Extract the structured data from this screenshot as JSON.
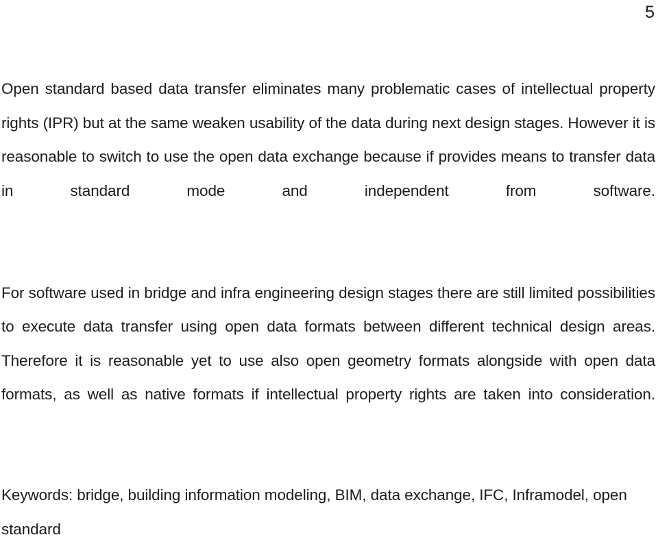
{
  "document": {
    "page_number": "5",
    "text_color": "#1c1c1c",
    "background_color": "#ffffff",
    "paragraphs": [
      {
        "id": "paragraph-open-standard",
        "text": "Open standard based data transfer eliminates many problematic cases of intellectual property rights (IPR) but at the same weaken usability of the data during next design stages. However it is reasonable to switch to use the open data exchange because if provides means to transfer data in standard mode and independent from software."
      },
      {
        "id": "paragraph-bridge-software",
        "text": "For software used in bridge and infra engineering design stages there are still limited possibilities to execute data transfer using open data formats between different technical design areas. Therefore it is reasonable yet to use also open geometry formats alongside with open data formats, as well as native formats if intellectual property rights are taken into consideration."
      }
    ],
    "keywords_line": "Keywords: bridge, building information modeling, BIM, data exchange, IFC, Inframodel, open standard"
  }
}
